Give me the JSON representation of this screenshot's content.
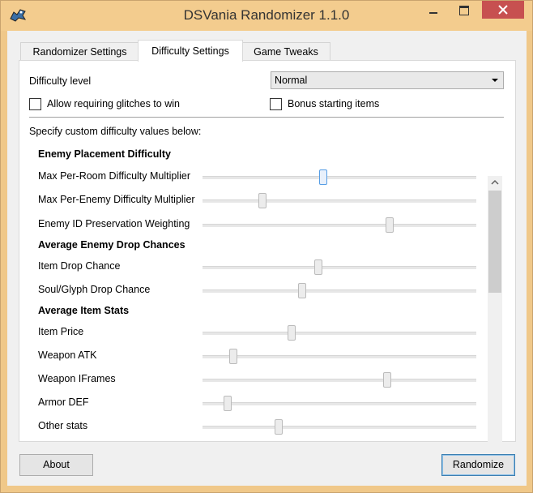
{
  "window": {
    "title": "DSVania Randomizer 1.1.0",
    "icon": "app-dragon-icon",
    "accent_color": "#f3cc8e",
    "controls": [
      "minimize-icon",
      "maximize-icon",
      "close-icon"
    ]
  },
  "tabs": [
    {
      "label": "Randomizer Settings",
      "active": false
    },
    {
      "label": "Difficulty Settings",
      "active": true
    },
    {
      "label": "Game Tweaks",
      "active": false
    }
  ],
  "difficulty": {
    "level_label": "Difficulty level",
    "level_value": "Normal",
    "glitches_label": "Allow requiring glitches to win",
    "glitches_checked": false,
    "bonus_label": "Bonus starting items",
    "bonus_checked": false,
    "custom_label": "Specify custom difficulty values below:"
  },
  "sections": [
    {
      "heading": "Enemy Placement Difficulty",
      "sliders": [
        {
          "label": "Max Per-Room Difficulty Multiplier",
          "value": 0.44,
          "focused": true
        },
        {
          "label": "Max Per-Enemy Difficulty Multiplier",
          "value": 0.21,
          "focused": false
        },
        {
          "label": "Enemy ID Preservation Weighting",
          "value": 0.69,
          "focused": false
        }
      ]
    },
    {
      "heading": "Average Enemy Drop Chances",
      "sliders": [
        {
          "label": "Item Drop Chance",
          "value": 0.42,
          "focused": false
        },
        {
          "label": "Soul/Glyph Drop Chance",
          "value": 0.36,
          "focused": false
        }
      ]
    },
    {
      "heading": "Average Item Stats",
      "sliders": [
        {
          "label": "Item Price",
          "value": 0.32,
          "focused": false
        },
        {
          "label": "Weapon ATK",
          "value": 0.1,
          "focused": false
        },
        {
          "label": "Weapon IFrames",
          "value": 0.68,
          "focused": false
        },
        {
          "label": "Armor DEF",
          "value": 0.08,
          "focused": false
        },
        {
          "label": "Other stats",
          "value": 0.27,
          "focused": false
        }
      ]
    }
  ],
  "buttons": {
    "about": "About",
    "randomize": "Randomize"
  }
}
